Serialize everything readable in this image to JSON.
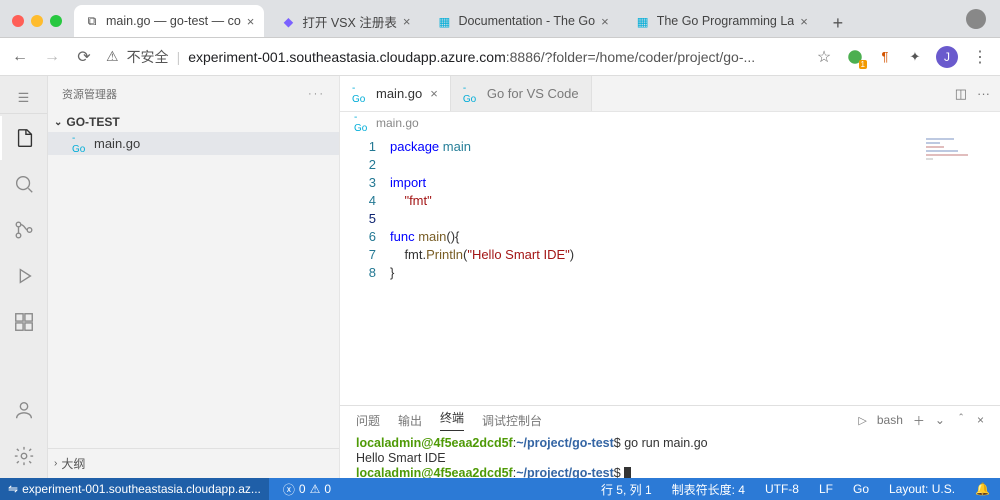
{
  "browser": {
    "tabs": [
      {
        "title": "main.go — go-test — co"
      },
      {
        "title": "打开 VSX 注册表"
      },
      {
        "title": "Documentation - The Go"
      },
      {
        "title": "The Go Programming La"
      }
    ],
    "insecure": "不安全",
    "url_host": "experiment-001.southeastasia.cloudapp.azure.com",
    "url_rest": ":8886/?folder=/home/coder/project/go-...",
    "avatar": "J"
  },
  "ide": {
    "explorer_title": "资源管理器",
    "project": "GO-TEST",
    "file": "main.go",
    "outline": "大纲",
    "tabs": [
      {
        "label": "main.go",
        "active": true
      },
      {
        "label": "Go for VS Code",
        "active": false
      }
    ],
    "breadcrumb": "main.go",
    "code_lines": [
      {
        "n": 1,
        "html": "<span class='kw'>package</span> <span class='pkg'>main</span>"
      },
      {
        "n": 2,
        "html": ""
      },
      {
        "n": 3,
        "html": "<span class='kw'>import</span>"
      },
      {
        "n": 4,
        "html": "    <span class='str'>\"fmt\"</span>"
      },
      {
        "n": 5,
        "html": "",
        "current": true
      },
      {
        "n": 6,
        "html": "<span class='kw'>func</span> <span class='fn'>main</span>(){"
      },
      {
        "n": 7,
        "html": "    fmt.<span class='fn'>Println</span>(<span class='str'>\"Hello Smart IDE\"</span>)"
      },
      {
        "n": 8,
        "html": "}"
      }
    ],
    "panel": {
      "tabs": [
        "问题",
        "输出",
        "终端",
        "调试控制台"
      ],
      "active": "终端",
      "shell": "bash",
      "lines": [
        {
          "type": "prompt",
          "user": "localadmin@4f5eaa2dcd5f",
          "path": "~/project/go-test",
          "cmd": "go run main.go"
        },
        {
          "type": "out",
          "text": "Hello Smart IDE"
        },
        {
          "type": "prompt",
          "user": "localadmin@4f5eaa2dcd5f",
          "path": "~/project/go-test",
          "cmd": ""
        }
      ]
    },
    "status": {
      "remote": "experiment-001.southeastasia.cloudapp.az...",
      "errors": "0",
      "warnings": "0",
      "pos": "行 5, 列 1",
      "tab": "制表符长度: 4",
      "enc": "UTF-8",
      "eol": "LF",
      "lang": "Go",
      "layout": "Layout: U.S."
    }
  }
}
